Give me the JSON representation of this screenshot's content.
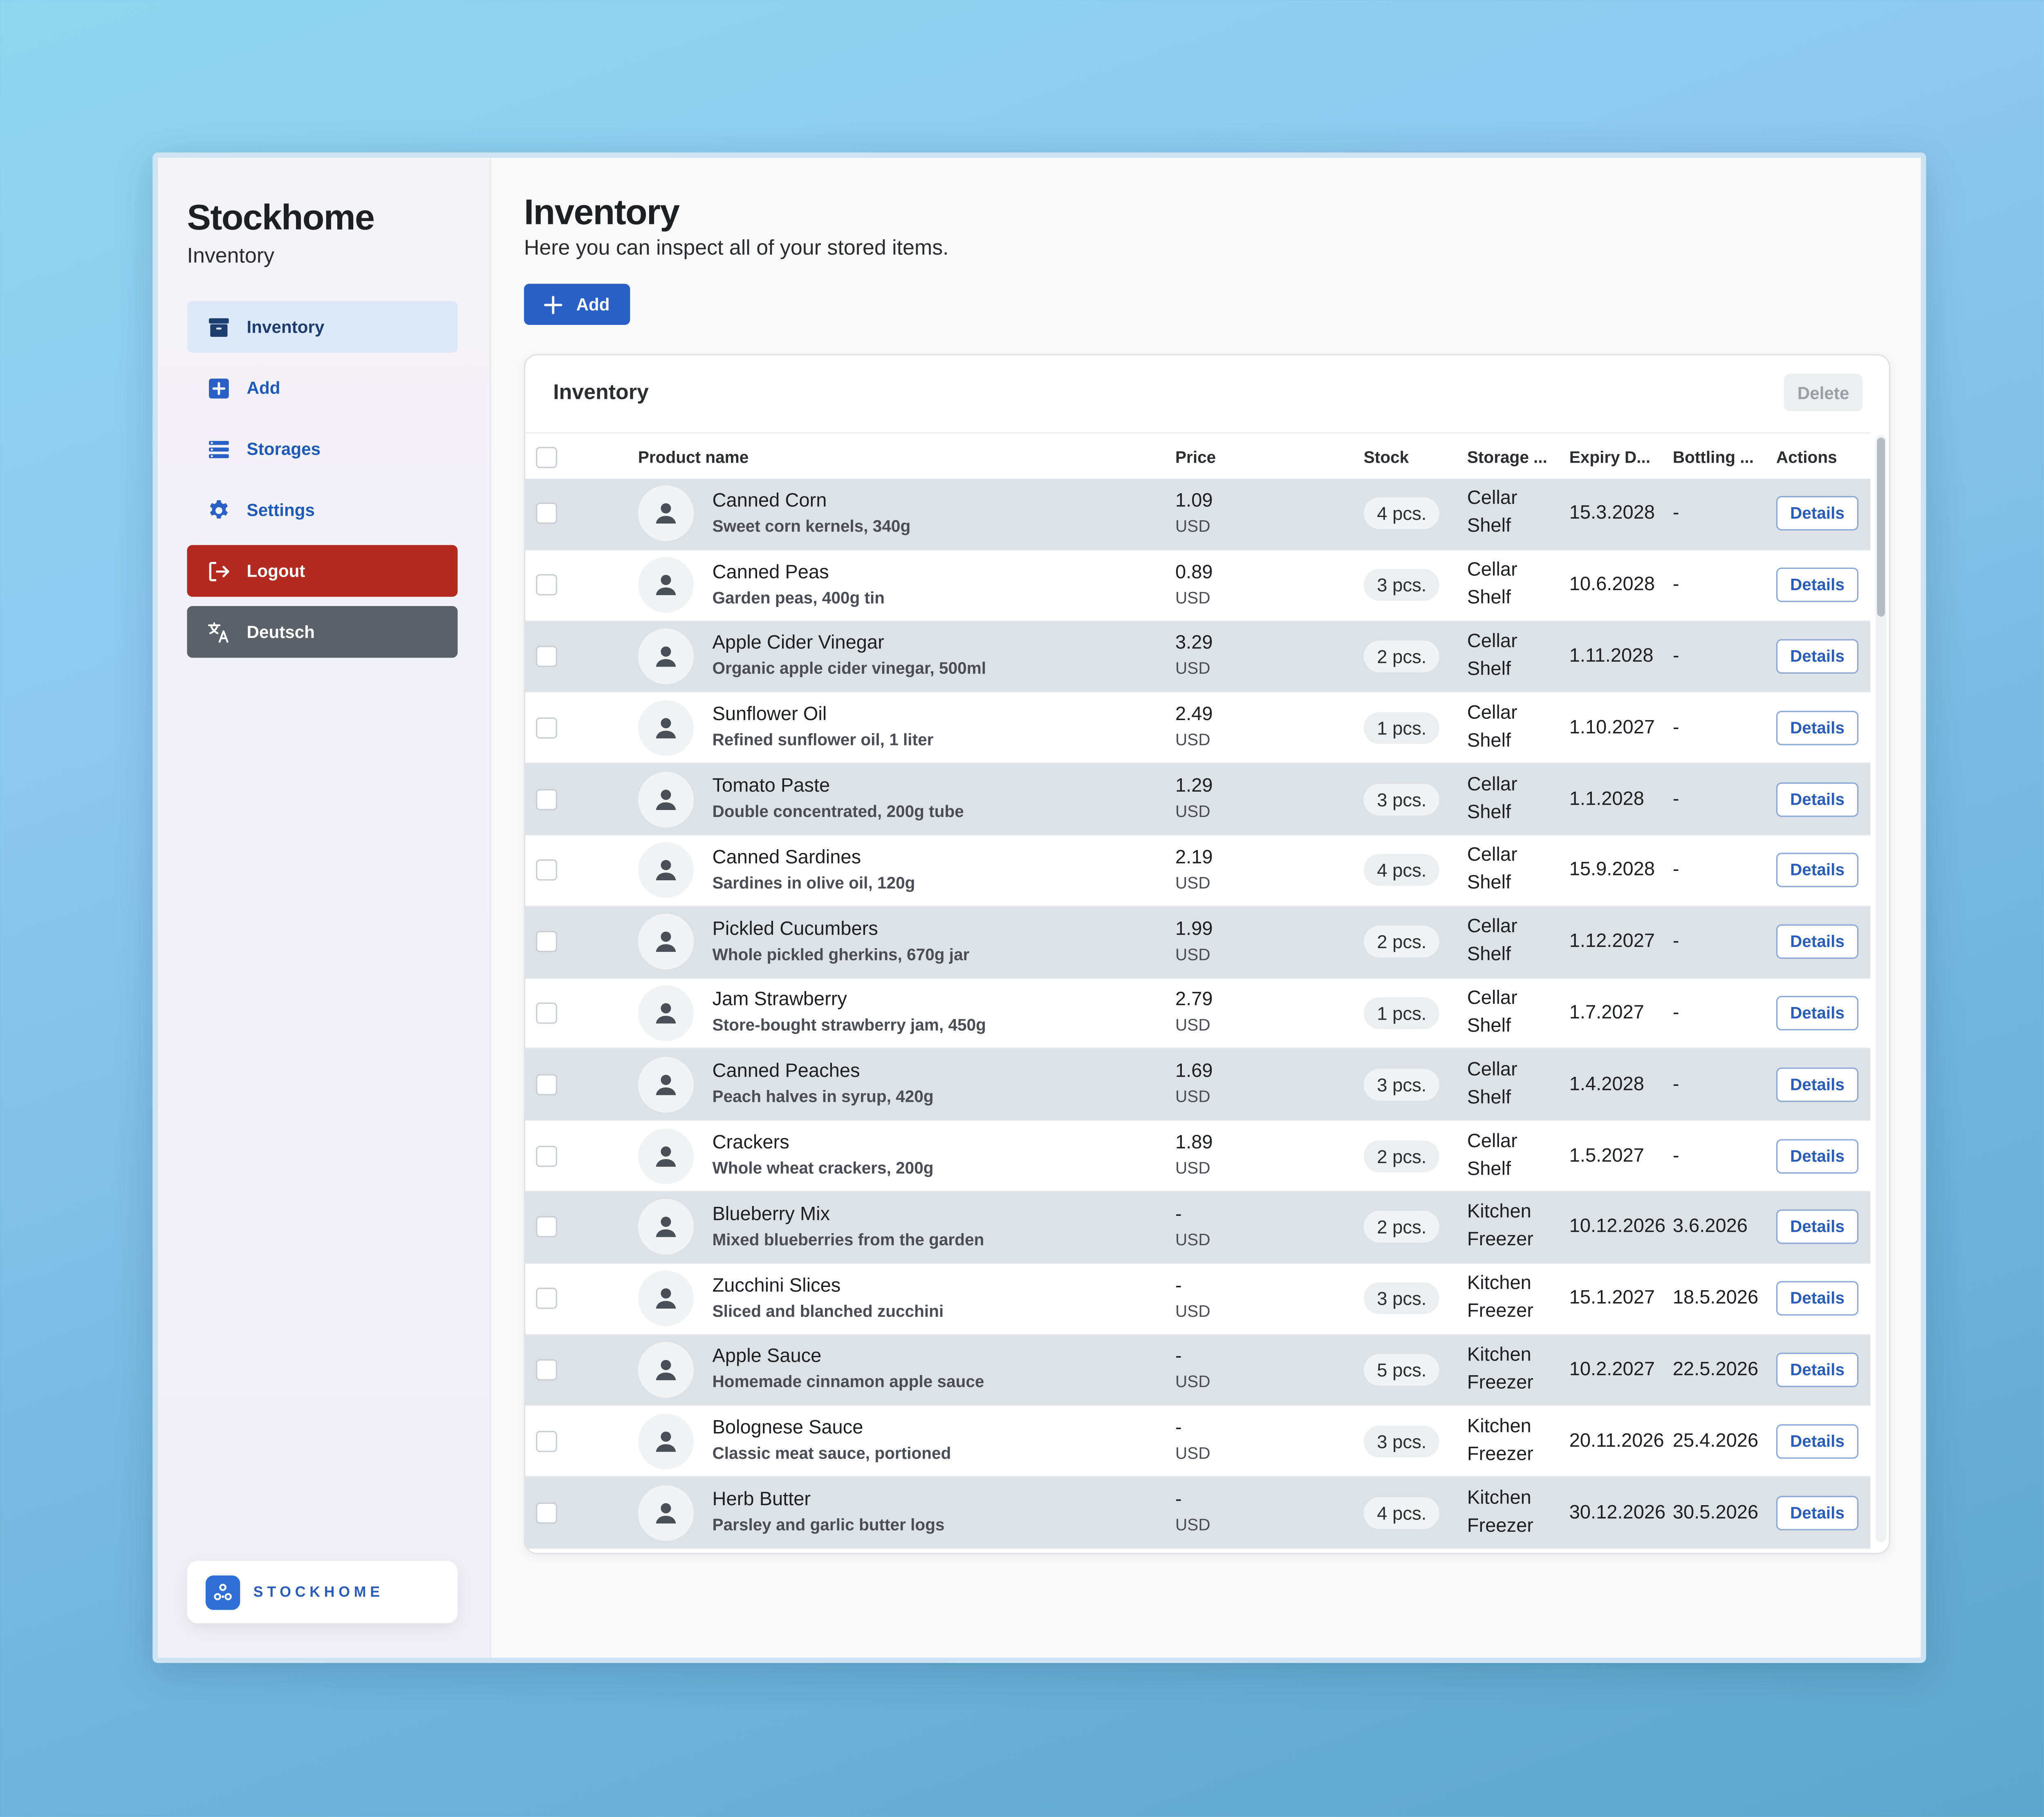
{
  "sidebar": {
    "brand_title": "Stockhome",
    "brand_subtitle": "Inventory",
    "items": [
      {
        "label": "Inventory",
        "icon": "archive-icon",
        "state": "active"
      },
      {
        "label": "Add",
        "icon": "plus-square-icon",
        "state": "normal"
      },
      {
        "label": "Storages",
        "icon": "list-icon",
        "state": "normal"
      },
      {
        "label": "Settings",
        "icon": "gear-icon",
        "state": "normal"
      },
      {
        "label": "Logout",
        "icon": "logout-icon",
        "state": "danger"
      },
      {
        "label": "Deutsch",
        "icon": "translate-icon",
        "state": "secondary"
      }
    ],
    "logo_text": "STOCKHOME"
  },
  "main": {
    "title": "Inventory",
    "description": "Here you can inspect all of your stored items.",
    "add_label": "Add"
  },
  "table": {
    "title": "Inventory",
    "delete_label": "Delete",
    "columns": {
      "product": "Product name",
      "price": "Price",
      "stock": "Stock",
      "storage": "Storage ...",
      "expiry": "Expiry D...",
      "bottling": "Bottling ...",
      "actions": "Actions"
    },
    "details_label": "Details",
    "rows": [
      {
        "name": "Canned Corn",
        "desc": "Sweet corn kernels, 340g",
        "price": "1.09",
        "currency": "USD",
        "stock": "4 pcs.",
        "storage_1": "Cellar",
        "storage_2": "Shelf",
        "expiry": "15.3.2028",
        "bottling": "-"
      },
      {
        "name": "Canned Peas",
        "desc": "Garden peas, 400g tin",
        "price": "0.89",
        "currency": "USD",
        "stock": "3 pcs.",
        "storage_1": "Cellar",
        "storage_2": "Shelf",
        "expiry": "10.6.2028",
        "bottling": "-"
      },
      {
        "name": "Apple Cider Vinegar",
        "desc": "Organic apple cider vinegar, 500ml",
        "price": "3.29",
        "currency": "USD",
        "stock": "2 pcs.",
        "storage_1": "Cellar",
        "storage_2": "Shelf",
        "expiry": "1.11.2028",
        "bottling": "-"
      },
      {
        "name": "Sunflower Oil",
        "desc": "Refined sunflower oil, 1 liter",
        "price": "2.49",
        "currency": "USD",
        "stock": "1 pcs.",
        "storage_1": "Cellar",
        "storage_2": "Shelf",
        "expiry": "1.10.2027",
        "bottling": "-"
      },
      {
        "name": "Tomato Paste",
        "desc": "Double concentrated, 200g tube",
        "price": "1.29",
        "currency": "USD",
        "stock": "3 pcs.",
        "storage_1": "Cellar",
        "storage_2": "Shelf",
        "expiry": "1.1.2028",
        "bottling": "-"
      },
      {
        "name": "Canned Sardines",
        "desc": "Sardines in olive oil, 120g",
        "price": "2.19",
        "currency": "USD",
        "stock": "4 pcs.",
        "storage_1": "Cellar",
        "storage_2": "Shelf",
        "expiry": "15.9.2028",
        "bottling": "-"
      },
      {
        "name": "Pickled Cucumbers",
        "desc": "Whole pickled gherkins, 670g jar",
        "price": "1.99",
        "currency": "USD",
        "stock": "2 pcs.",
        "storage_1": "Cellar",
        "storage_2": "Shelf",
        "expiry": "1.12.2027",
        "bottling": "-"
      },
      {
        "name": "Jam Strawberry",
        "desc": "Store-bought strawberry jam, 450g",
        "price": "2.79",
        "currency": "USD",
        "stock": "1 pcs.",
        "storage_1": "Cellar",
        "storage_2": "Shelf",
        "expiry": "1.7.2027",
        "bottling": "-"
      },
      {
        "name": "Canned Peaches",
        "desc": "Peach halves in syrup, 420g",
        "price": "1.69",
        "currency": "USD",
        "stock": "3 pcs.",
        "storage_1": "Cellar",
        "storage_2": "Shelf",
        "expiry": "1.4.2028",
        "bottling": "-"
      },
      {
        "name": "Crackers",
        "desc": "Whole wheat crackers, 200g",
        "price": "1.89",
        "currency": "USD",
        "stock": "2 pcs.",
        "storage_1": "Cellar",
        "storage_2": "Shelf",
        "expiry": "1.5.2027",
        "bottling": "-"
      },
      {
        "name": "Blueberry Mix",
        "desc": "Mixed blueberries from the garden",
        "price": "-",
        "currency": "USD",
        "stock": "2 pcs.",
        "storage_1": "Kitchen",
        "storage_2": "Freezer",
        "expiry": "10.12.2026",
        "bottling": "3.6.2026"
      },
      {
        "name": "Zucchini Slices",
        "desc": "Sliced and blanched zucchini",
        "price": "-",
        "currency": "USD",
        "stock": "3 pcs.",
        "storage_1": "Kitchen",
        "storage_2": "Freezer",
        "expiry": "15.1.2027",
        "bottling": "18.5.2026"
      },
      {
        "name": "Apple Sauce",
        "desc": "Homemade cinnamon apple sauce",
        "price": "-",
        "currency": "USD",
        "stock": "5 pcs.",
        "storage_1": "Kitchen",
        "storage_2": "Freezer",
        "expiry": "10.2.2027",
        "bottling": "22.5.2026"
      },
      {
        "name": "Bolognese Sauce",
        "desc": "Classic meat sauce, portioned",
        "price": "-",
        "currency": "USD",
        "stock": "3 pcs.",
        "storage_1": "Kitchen",
        "storage_2": "Freezer",
        "expiry": "20.11.2026",
        "bottling": "25.4.2026"
      },
      {
        "name": "Herb Butter",
        "desc": "Parsley and garlic butter logs",
        "price": "-",
        "currency": "USD",
        "stock": "4 pcs.",
        "storage_1": "Kitchen",
        "storage_2": "Freezer",
        "expiry": "30.12.2026",
        "bottling": "30.5.2026"
      }
    ]
  },
  "colors": {
    "accent": "#2a5fc6",
    "danger": "#b22a20",
    "secondary": "#5b6267",
    "active_nav": "#dde9f7"
  }
}
